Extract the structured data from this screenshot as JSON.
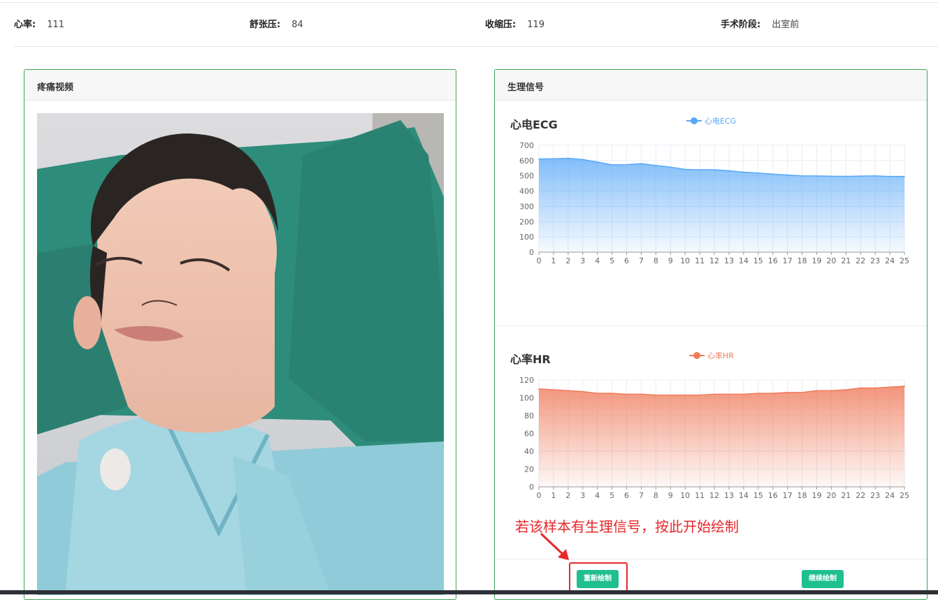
{
  "vitals": [
    {
      "label": "心率:",
      "value": "111"
    },
    {
      "label": "舒张压:",
      "value": "84"
    },
    {
      "label": "收缩压:",
      "value": "119"
    },
    {
      "label": "手术阶段:",
      "value": "出室前"
    }
  ],
  "video_panel": {
    "title": "疼痛视频"
  },
  "signal_panel": {
    "title": "生理信号"
  },
  "ecg": {
    "title": "心电ECG",
    "legend": "心电ECG",
    "color": "#58a8f7"
  },
  "hr": {
    "title": "心率HR",
    "legend": "心率HR",
    "color": "#f07a5a"
  },
  "annotation": "若该样本有生理信号，按此开始绘制",
  "buttons": {
    "redraw": "重新绘制",
    "continue": "继续绘制"
  },
  "chart_data": [
    {
      "type": "area",
      "title": "心电ECG",
      "series": [
        {
          "name": "心电ECG",
          "values": [
            610,
            612,
            615,
            607,
            590,
            572,
            573,
            580,
            568,
            557,
            542,
            540,
            540,
            533,
            524,
            518,
            511,
            505,
            500,
            499,
            497,
            496,
            498,
            500,
            495,
            495
          ]
        }
      ],
      "x": [
        0,
        1,
        2,
        3,
        4,
        5,
        6,
        7,
        8,
        9,
        10,
        11,
        12,
        13,
        14,
        15,
        16,
        17,
        18,
        19,
        20,
        21,
        22,
        23,
        24,
        25
      ],
      "ylim": [
        0,
        700
      ],
      "yticks": [
        0,
        100,
        200,
        300,
        400,
        500,
        600,
        700
      ],
      "grid": true,
      "legend": "top"
    },
    {
      "type": "area",
      "title": "心率HR",
      "series": [
        {
          "name": "心率HR",
          "values": [
            110,
            109,
            108,
            107,
            105,
            105,
            104,
            104,
            103,
            103,
            103,
            103,
            104,
            104,
            104,
            105,
            105,
            106,
            106,
            108,
            108,
            109,
            111,
            111,
            112,
            113
          ]
        }
      ],
      "x": [
        0,
        1,
        2,
        3,
        4,
        5,
        6,
        7,
        8,
        9,
        10,
        11,
        12,
        13,
        14,
        15,
        16,
        17,
        18,
        19,
        20,
        21,
        22,
        23,
        24,
        25
      ],
      "ylim": [
        0,
        120
      ],
      "yticks": [
        0,
        20,
        40,
        60,
        80,
        100,
        120
      ],
      "grid": true,
      "legend": "top"
    }
  ]
}
